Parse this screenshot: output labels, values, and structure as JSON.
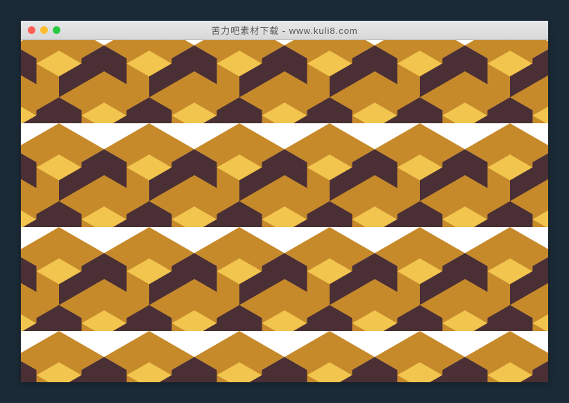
{
  "window": {
    "title": "苦力吧素材下载 - www.kuli8.com"
  },
  "pattern": {
    "description": "isometric-cube-tessellation",
    "colors": {
      "light": "#f1c54e",
      "medium": "#c78a2b",
      "dark": "#4a2f34"
    }
  }
}
